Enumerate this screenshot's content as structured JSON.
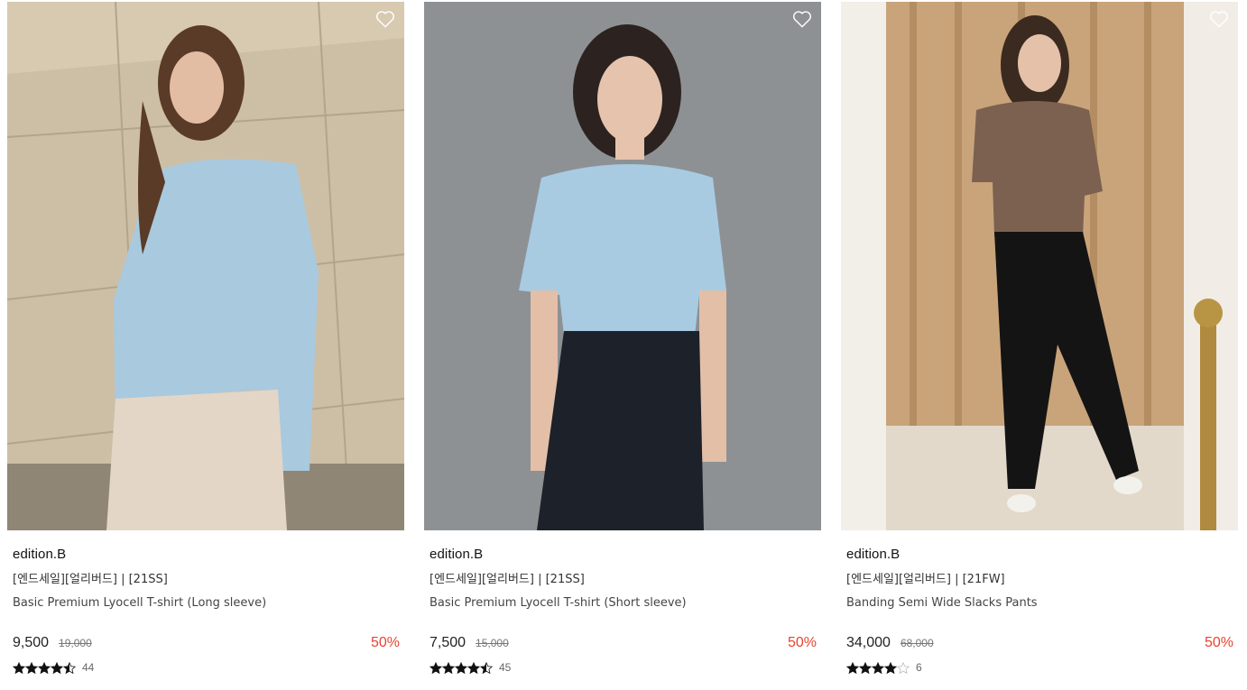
{
  "products": [
    {
      "brand": "edition.B",
      "tag": "[엔드세일][얼리버드] | [21SS]",
      "name": "Basic Premium Lyocell T-shirt (Long sleeve)",
      "price": "9,500",
      "original_price": "19,000",
      "discount": "50%",
      "rating": 4.5,
      "review_count": "44",
      "wishlist_icon": "heart-outline-icon"
    },
    {
      "brand": "edition.B",
      "tag": "[엔드세일][얼리버드] | [21SS]",
      "name": "Basic Premium Lyocell T-shirt (Short sleeve)",
      "price": "7,500",
      "original_price": "15,000",
      "discount": "50%",
      "rating": 4.5,
      "review_count": "45",
      "wishlist_icon": "heart-outline-icon"
    },
    {
      "brand": "edition.B",
      "tag": "[엔드세일][얼리버드] | [21FW]",
      "name": "Banding Semi Wide Slacks Pants",
      "price": "34,000",
      "original_price": "68,000",
      "discount": "50%",
      "rating": 4,
      "review_count": "6",
      "wishlist_icon": "heart-outline-icon"
    }
  ],
  "colors": {
    "discount": "#e8432e",
    "star": "#111111",
    "star_empty": "#bbbbbb"
  }
}
